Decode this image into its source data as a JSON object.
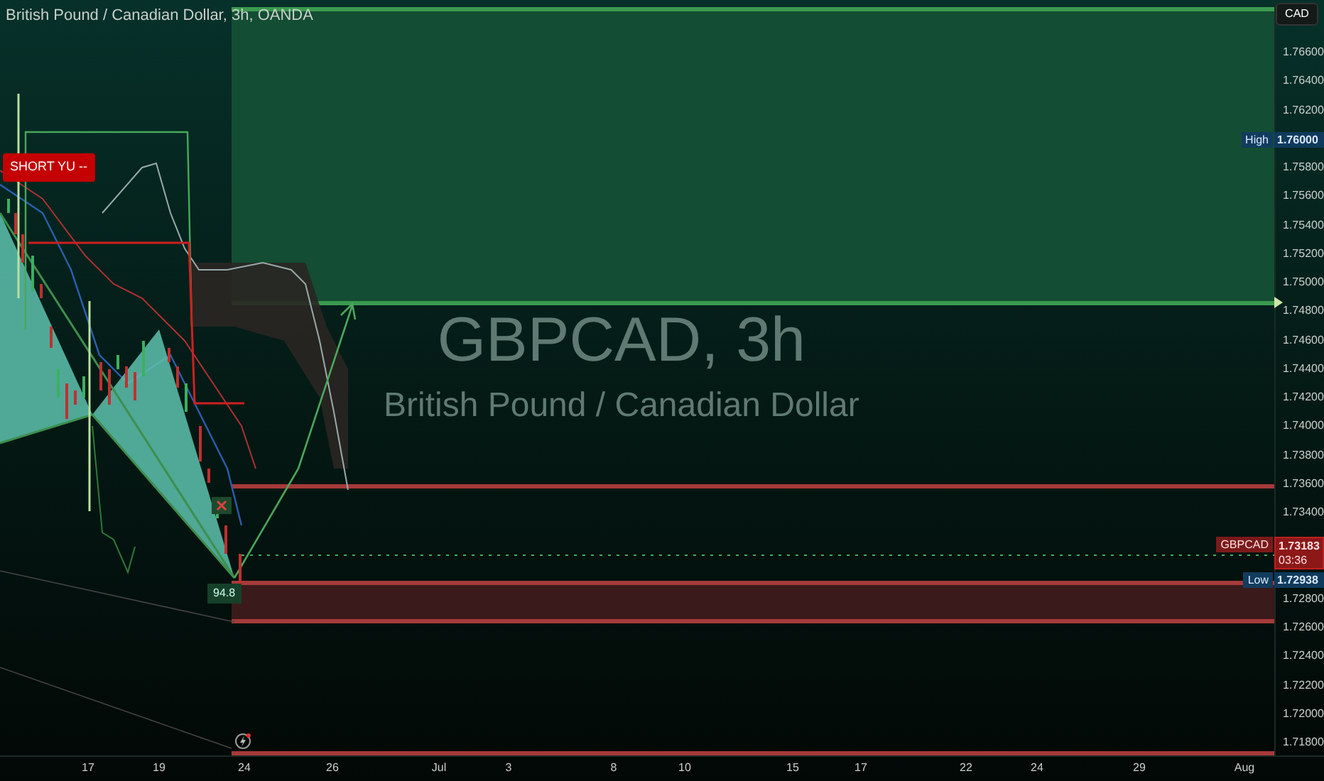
{
  "header": {
    "title": "British Pound / Canadian Dollar, 3h, OANDA"
  },
  "watermark": {
    "symbol": "GBPCAD, 3h",
    "description": "British Pound / Canadian Dollar"
  },
  "price_axis": {
    "currency": "CAD",
    "ticks": [
      "1.76600",
      "1.76400",
      "1.76200",
      "1.75800",
      "1.75600",
      "1.75400",
      "1.75200",
      "1.75000",
      "1.74800",
      "1.74600",
      "1.74400",
      "1.74200",
      "1.74000",
      "1.73800",
      "1.73600",
      "1.73400",
      "1.72800",
      "1.72600",
      "1.72400",
      "1.72200",
      "1.72000",
      "1.71800"
    ]
  },
  "price_markers": [
    {
      "kind": "high",
      "label": "High",
      "price": "1.76000"
    },
    {
      "kind": "last",
      "label": "GBPCAD",
      "price": "1.73183",
      "countdown": "03:36"
    },
    {
      "kind": "low",
      "label": "Low",
      "price": "1.72938"
    }
  ],
  "time_axis": {
    "labels": [
      "17",
      "19",
      "24",
      "26",
      "Jul",
      "3",
      "8",
      "10",
      "15",
      "17",
      "22",
      "24",
      "29",
      "Aug"
    ]
  },
  "annotations": [
    {
      "kind": "signal",
      "text": "SHORT YU --"
    },
    {
      "kind": "pattern",
      "text": "94.8"
    }
  ]
}
